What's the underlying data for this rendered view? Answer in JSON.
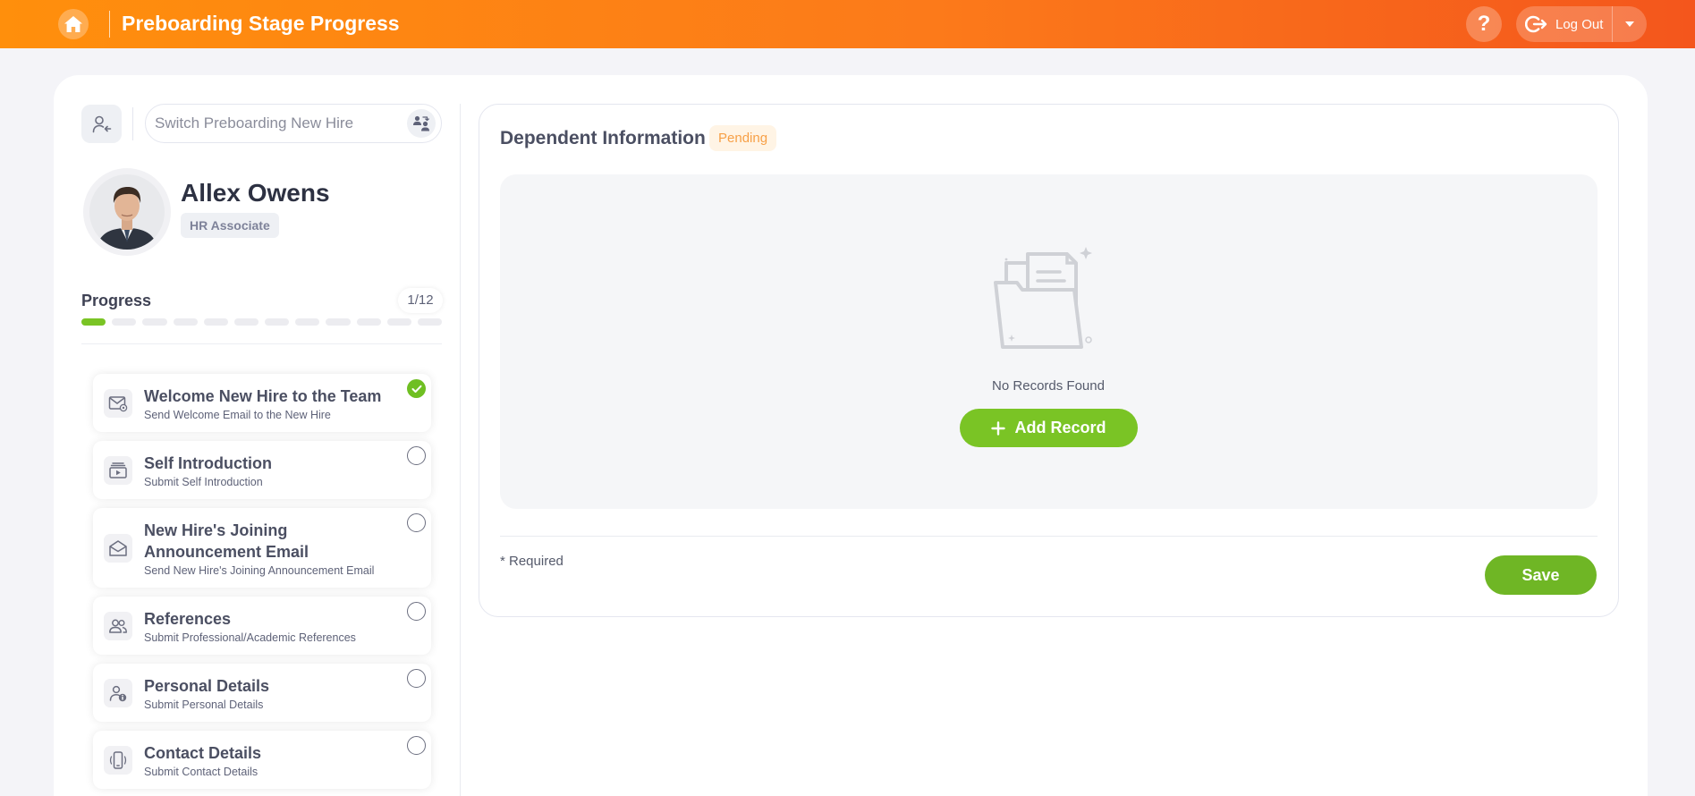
{
  "header": {
    "title": "Preboarding Stage Progress",
    "logout_label": "Log Out"
  },
  "sidebar": {
    "search_placeholder": "Switch Preboarding New Hire",
    "hire": {
      "name": "Allex Owens",
      "role": "HR Associate"
    },
    "progress": {
      "label": "Progress",
      "count": "1/12",
      "completed": 1,
      "total": 12
    },
    "stages": [
      {
        "title": "Welcome New Hire to the Team",
        "subtitle": "Send Welcome Email to the New Hire",
        "icon": "email-at-icon",
        "status": "completed"
      },
      {
        "title": "Self Introduction",
        "subtitle": "Submit Self Introduction",
        "icon": "video-stack-icon",
        "status": "pending"
      },
      {
        "title": "New Hire's Joining Announcement Email",
        "subtitle": "Send New Hire's Joining Announcement Email",
        "icon": "envelope-open-icon",
        "status": "pending"
      },
      {
        "title": "References",
        "subtitle": "Submit Professional/Academic References",
        "icon": "users-icon",
        "status": "pending"
      },
      {
        "title": "Personal Details",
        "subtitle": "Submit Personal Details",
        "icon": "user-info-icon",
        "status": "pending"
      },
      {
        "title": "Contact Details",
        "subtitle": "Submit Contact Details",
        "icon": "phone-icon",
        "status": "pending"
      }
    ]
  },
  "main": {
    "section_title": "Dependent Information",
    "status_badge": "Pending",
    "empty_text": "No Records Found",
    "add_label": "Add Record",
    "required_note": "* Required",
    "save_label": "Save"
  },
  "colors": {
    "header_start": "#ff8f0c",
    "header_end": "#f4561c",
    "accent_green": "#7ac425",
    "pending_text": "#f7a047"
  }
}
